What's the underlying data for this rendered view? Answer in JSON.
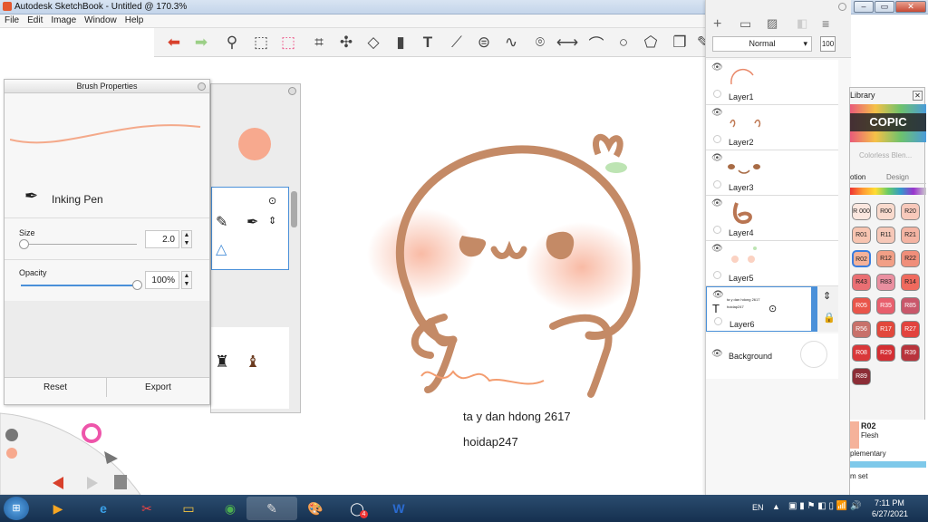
{
  "window": {
    "title": "Autodesk SketchBook - Untitled @ 170.3%",
    "min": "–",
    "max": "▭",
    "close": "✕"
  },
  "menu": [
    "File",
    "Edit",
    "Image",
    "Window",
    "Help"
  ],
  "toolbar": [
    "undo",
    "redo",
    "zoom",
    "select",
    "select-dashed",
    "crop",
    "lasso",
    "transform",
    "cylinder",
    "text",
    "ruler",
    "ellipse-guide",
    "curve",
    "perspective",
    "symmetry",
    "stroke",
    "circle",
    "shapes",
    "copy",
    "brush"
  ],
  "brush": {
    "title": "Brush Properties",
    "name": "Inking Pen",
    "size_label": "Size",
    "size_value": "2.0",
    "opacity_label": "Opacity",
    "opacity_value": "100%",
    "reset": "Reset",
    "export": "Export",
    "stroke_color": "#f4a98a",
    "dot_color": "#f7a98e",
    "size_level": 0.02,
    "opacity_level": 1.0
  },
  "canvas": {
    "line1": "ta y dan hdong 2617",
    "line2": "hoidap247",
    "outline_color": "#c48a66"
  },
  "layers": {
    "blend": "Normal",
    "opacity": "100",
    "items": [
      {
        "name": "Layer1"
      },
      {
        "name": "Layer2"
      },
      {
        "name": "Layer3"
      },
      {
        "name": "Layer4"
      },
      {
        "name": "Layer5"
      },
      {
        "name": "Layer6",
        "thumb_text": "ta y dan hdong 2617",
        "thumb_text2": "hoidap247"
      }
    ],
    "background": "Background"
  },
  "copic": {
    "title": "Library",
    "logo": "COPIC",
    "colorless": "Colorless Blen...",
    "tab1": "otion",
    "tab2": "Design",
    "swatches": [
      {
        "code": "R 000",
        "color": "#fbe7df"
      },
      {
        "code": "R00",
        "color": "#f9dacd"
      },
      {
        "code": "R20",
        "color": "#f8c9bb"
      },
      {
        "code": "R01",
        "color": "#f7c4b0"
      },
      {
        "code": "R11",
        "color": "#f6c8b8"
      },
      {
        "code": "R21",
        "color": "#f4b4a3"
      },
      {
        "code": "R02",
        "color": "#f5b29a"
      },
      {
        "code": "R12",
        "color": "#f29f86"
      },
      {
        "code": "R22",
        "color": "#f08e7a"
      },
      {
        "code": "R43",
        "color": "#ea6f73"
      },
      {
        "code": "R83",
        "color": "#ea8fa0"
      },
      {
        "code": "R14",
        "color": "#ef6a5e"
      },
      {
        "code": "R05",
        "color": "#e9554a"
      },
      {
        "code": "R35",
        "color": "#e85f6d"
      },
      {
        "code": "R85",
        "color": "#c9576a"
      },
      {
        "code": "R56",
        "color": "#c8716a"
      },
      {
        "code": "R17",
        "color": "#e2483c"
      },
      {
        "code": "R27",
        "color": "#e2433e"
      },
      {
        "code": "R08",
        "color": "#d9383a"
      },
      {
        "code": "R29",
        "color": "#d42f33"
      },
      {
        "code": "R39",
        "color": "#b8343c"
      },
      {
        "code": "R89",
        "color": "#8c2d36"
      }
    ],
    "selected_code": "R02",
    "selected_name": "Flesh",
    "complementary": "plementary",
    "set": "m set"
  },
  "taskbar": {
    "lang": "EN",
    "time": "7:11 PM",
    "date": "6/27/2021",
    "zalo_badge": "4"
  }
}
